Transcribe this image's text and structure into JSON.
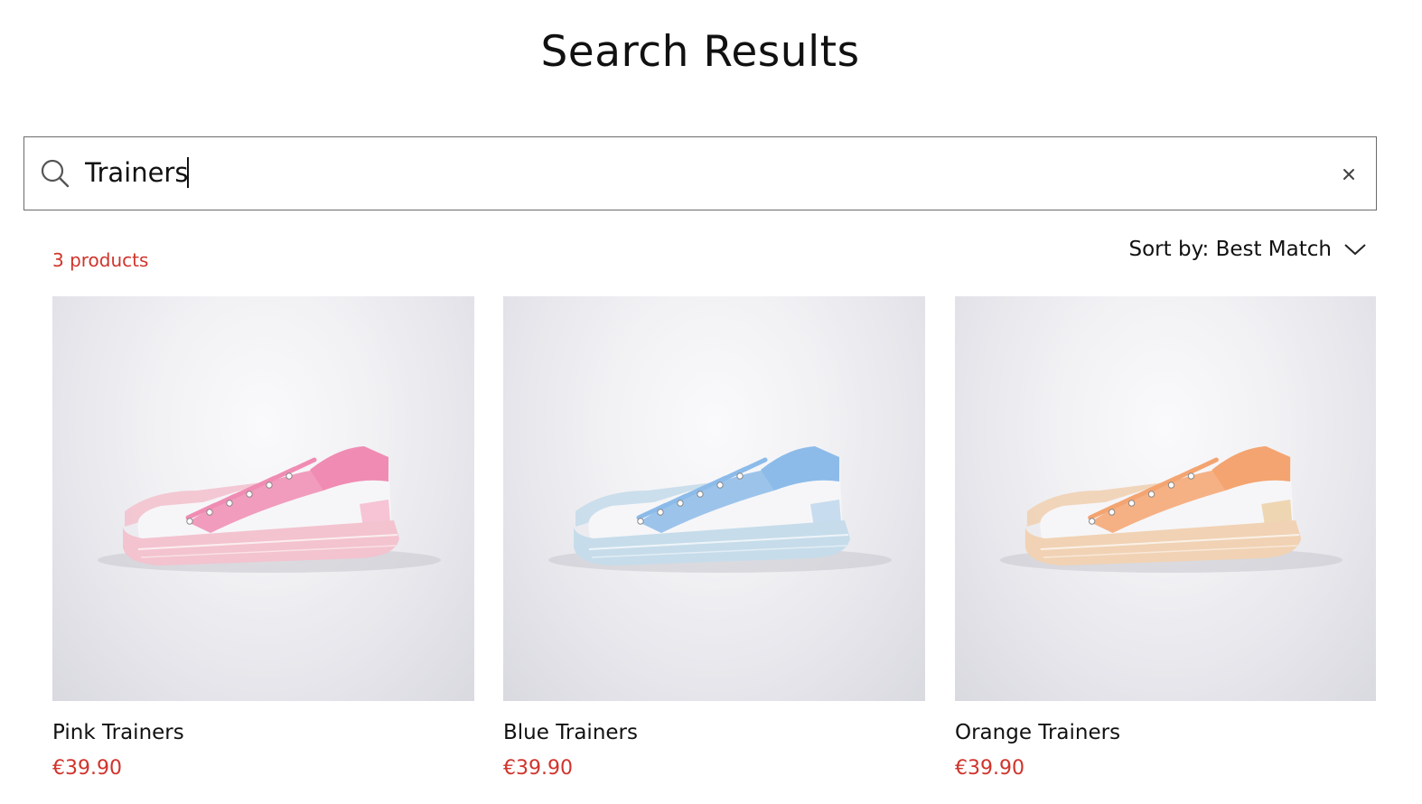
{
  "page": {
    "title": "Search Results"
  },
  "search": {
    "value": "Trainers",
    "clear_icon": "close-icon",
    "search_icon": "search-icon"
  },
  "results": {
    "count_label": "3 products",
    "sort_label": "Sort by: Best Match",
    "sort_icon": "chevron-down-icon"
  },
  "colors": {
    "accent": "#d0342c",
    "text": "#111111",
    "border": "#6b6b6b"
  },
  "products": [
    {
      "name": "Pink Trainers",
      "price": "€39.90",
      "shoe_color": "#f08cb3",
      "shoe_light": "#f6c4d5",
      "sole_color": "#f3c3cf"
    },
    {
      "name": "Blue Trainers",
      "price": "€39.90",
      "shoe_color": "#8cbbe9",
      "shoe_light": "#c7dcee",
      "sole_color": "#c6dcea"
    },
    {
      "name": "Orange Trainers",
      "price": "€39.90",
      "shoe_color": "#f4a470",
      "shoe_light": "#eed6b2",
      "sole_color": "#f1d2b4"
    }
  ]
}
